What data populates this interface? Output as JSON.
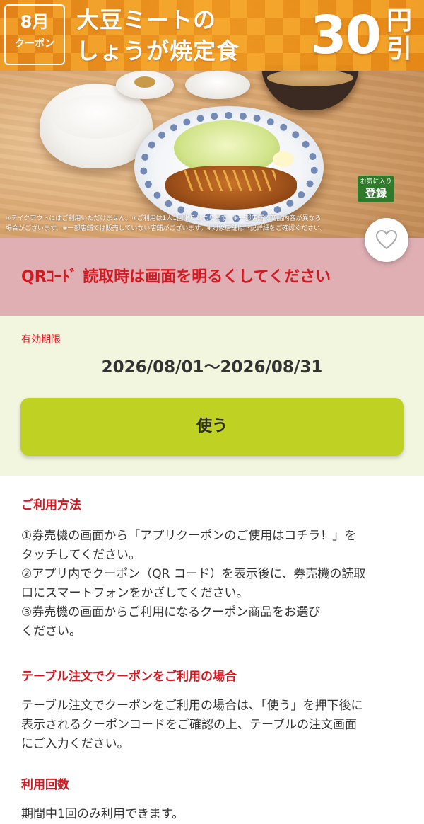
{
  "hero": {
    "month": "8月",
    "month_sub": "クーポン",
    "menu_line1": "大豆ミートの",
    "menu_line2": "しょうが焼定食",
    "discount_amount": "30",
    "discount_unit_1": "円",
    "discount_unit_2": "引",
    "disclaimer_1": "※テイクアウトにはご利用いただけません。※ご利用は1人1回限りとなります。※一部店舗で商品内容が異なる",
    "disclaimer_2": "場合がございます。※一部店舗では販売していない店舗がございます。※対象店舗は下記詳細をご確認ください。",
    "fav_line1": "お気に入り",
    "fav_line2": "登録"
  },
  "qr_notice": {
    "text": "QRｺｰﾄﾞ 読取時は画面を明るくしてください"
  },
  "validity": {
    "label": "有効期限",
    "period": "2026/08/01～2026/08/31"
  },
  "use_button": {
    "label": "使う"
  },
  "details": {
    "how_to_use": {
      "title": "ご利用方法",
      "steps": [
        "①券売機の画面から「アプリクーポンのご使用はコチラ！」を",
        "タッチしてください。",
        "②アプリ内でクーポン（QR コード）を表示後に、券売機の読取",
        "口にスマートフォンをかざしてください。",
        "③券売機の画面からご利用になるクーポン商品をお選び",
        "ください。"
      ]
    },
    "table_order": {
      "title": "テーブル注文でクーポンをご利用の場合",
      "lines": [
        "テーブル注文でクーポンをご利用の場合は、「使う」を押下後に",
        "表示されるクーポンコードをご確認の上、テーブルの注文画面",
        "にご入力ください。"
      ]
    },
    "usage_count": {
      "title": "利用回数",
      "text": "期間中1回のみ利用できます。"
    }
  },
  "icons": {
    "favorite": "heart-icon"
  },
  "colors": {
    "banner": "#e8891a",
    "notice_bg": "#dfafb3",
    "accent_red": "#d6171f",
    "validity_bg": "#f2f6df",
    "use_button": "#bfd122"
  }
}
